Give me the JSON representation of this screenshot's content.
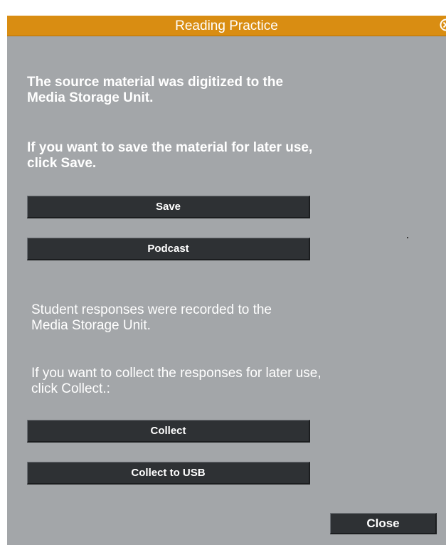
{
  "window": {
    "title": "Reading Practice",
    "close_icon": "close-circle-icon"
  },
  "source_section": {
    "line1": "The source material was digitized to the",
    "line2": "Media Storage Unit.",
    "line3": "If you want to save the material for later use,",
    "line4": "click Save."
  },
  "buttons": {
    "save": "Save",
    "podcast": "Podcast",
    "collect": "Collect",
    "collect_usb": "Collect to USB",
    "close": "Close"
  },
  "responses_section": {
    "line1": "Student responses were recorded to the",
    "line2": "Media Storage Unit.",
    "line3": "If you want to collect the responses for later use,",
    "line4": "click Collect.:"
  },
  "colors": {
    "titlebar": "#d98d12",
    "panel": "#a3a6a9",
    "button": "#2e3134",
    "text": "#ffffff"
  }
}
